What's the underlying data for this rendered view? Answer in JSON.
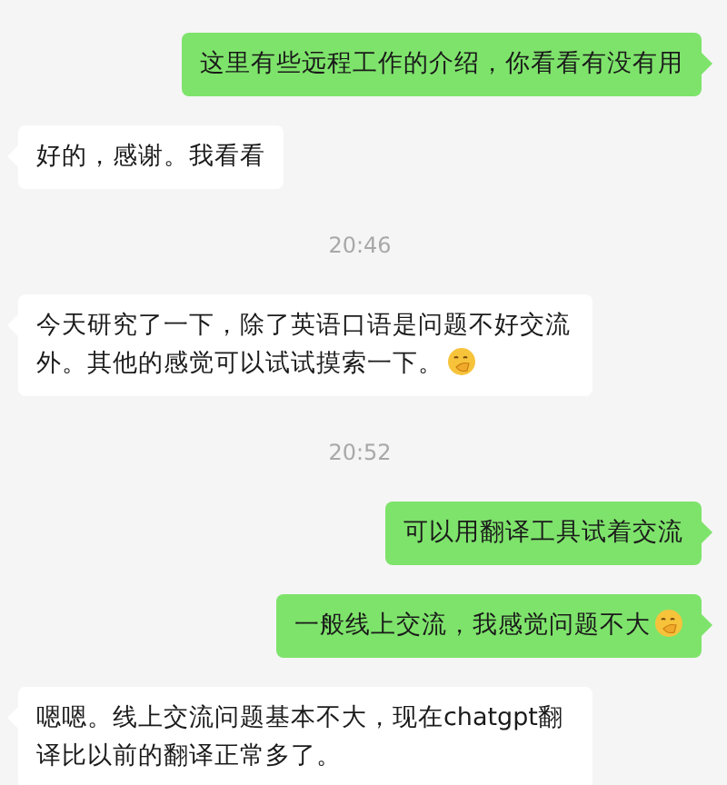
{
  "messages": [
    {
      "kind": "message",
      "outgoing": true,
      "text": "这里有些远程工作的介绍，你看看有没有用",
      "emoji": false
    },
    {
      "kind": "message",
      "outgoing": false,
      "text": "好的，感谢。我看看",
      "emoji": false
    },
    {
      "kind": "time",
      "text": "20:46"
    },
    {
      "kind": "message",
      "outgoing": false,
      "text": "今天研究了一下，除了英语口语是问题不好交流外。其他的感觉可以试试摸索一下。",
      "emoji": true
    },
    {
      "kind": "time",
      "text": "20:52"
    },
    {
      "kind": "message",
      "outgoing": true,
      "text": "可以用翻译工具试着交流",
      "emoji": false
    },
    {
      "kind": "message",
      "outgoing": true,
      "text": "一般线上交流，我感觉问题不大",
      "emoji": true
    },
    {
      "kind": "message",
      "outgoing": false,
      "text": "嗯嗯。线上交流问题基本不大，现在chatgpt翻译比以前的翻译正常多了。",
      "emoji": false
    }
  ]
}
